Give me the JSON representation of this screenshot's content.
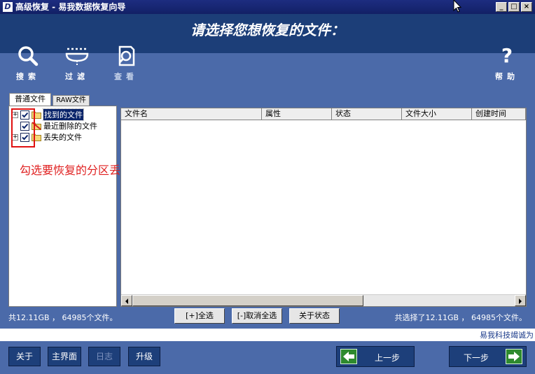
{
  "window": {
    "title": "高级恢复 - 易我数据恢复向导",
    "app_icon_letter": "D",
    "controls": {
      "minimize": "_",
      "maximize": "□",
      "close": "×"
    }
  },
  "heading": "请选择您想恢复的文件：",
  "toolbar": {
    "search_label": "搜索",
    "filter_label": "过滤",
    "view_label": "查看",
    "help_label": "帮助",
    "help_glyph": "?"
  },
  "tabs": {
    "normal": "普通文件",
    "raw": "RAW文件"
  },
  "tree": {
    "items": [
      {
        "label": "找到的文件",
        "checked": true,
        "expander": "+",
        "icon": "folder-icon",
        "selected": true
      },
      {
        "label": "最近删除的文件",
        "checked": true,
        "expander": "",
        "icon": "deleted-folder-icon",
        "selected": false
      },
      {
        "label": "丢失的文件",
        "checked": true,
        "expander": "+",
        "icon": "folder-icon",
        "selected": false
      }
    ]
  },
  "annotation": "勾选要恢复的分区丢失数据",
  "list": {
    "columns": [
      "文件名",
      "属性",
      "状态",
      "文件大小",
      "创建时间"
    ]
  },
  "status": {
    "left": "共12.11GB ， 64985个文件。",
    "right": "共选择了12.11GB ， 64985个文件。"
  },
  "actions": {
    "select_all": "[+]全选",
    "deselect_all": "[-]取消全选",
    "about_state": "关于状态"
  },
  "brand_text": "易我科技竭诚为",
  "bottom": {
    "about": "关于",
    "main": "主界面",
    "log": "日志",
    "upgrade": "升级",
    "prev": "上一步",
    "next": "下一步"
  },
  "colors": {
    "window_bg": "#4b6aa9",
    "header_bg": "#1c3e78",
    "annotation_red": "#e02020",
    "nav_arrow_green": "#2e8a2e"
  }
}
